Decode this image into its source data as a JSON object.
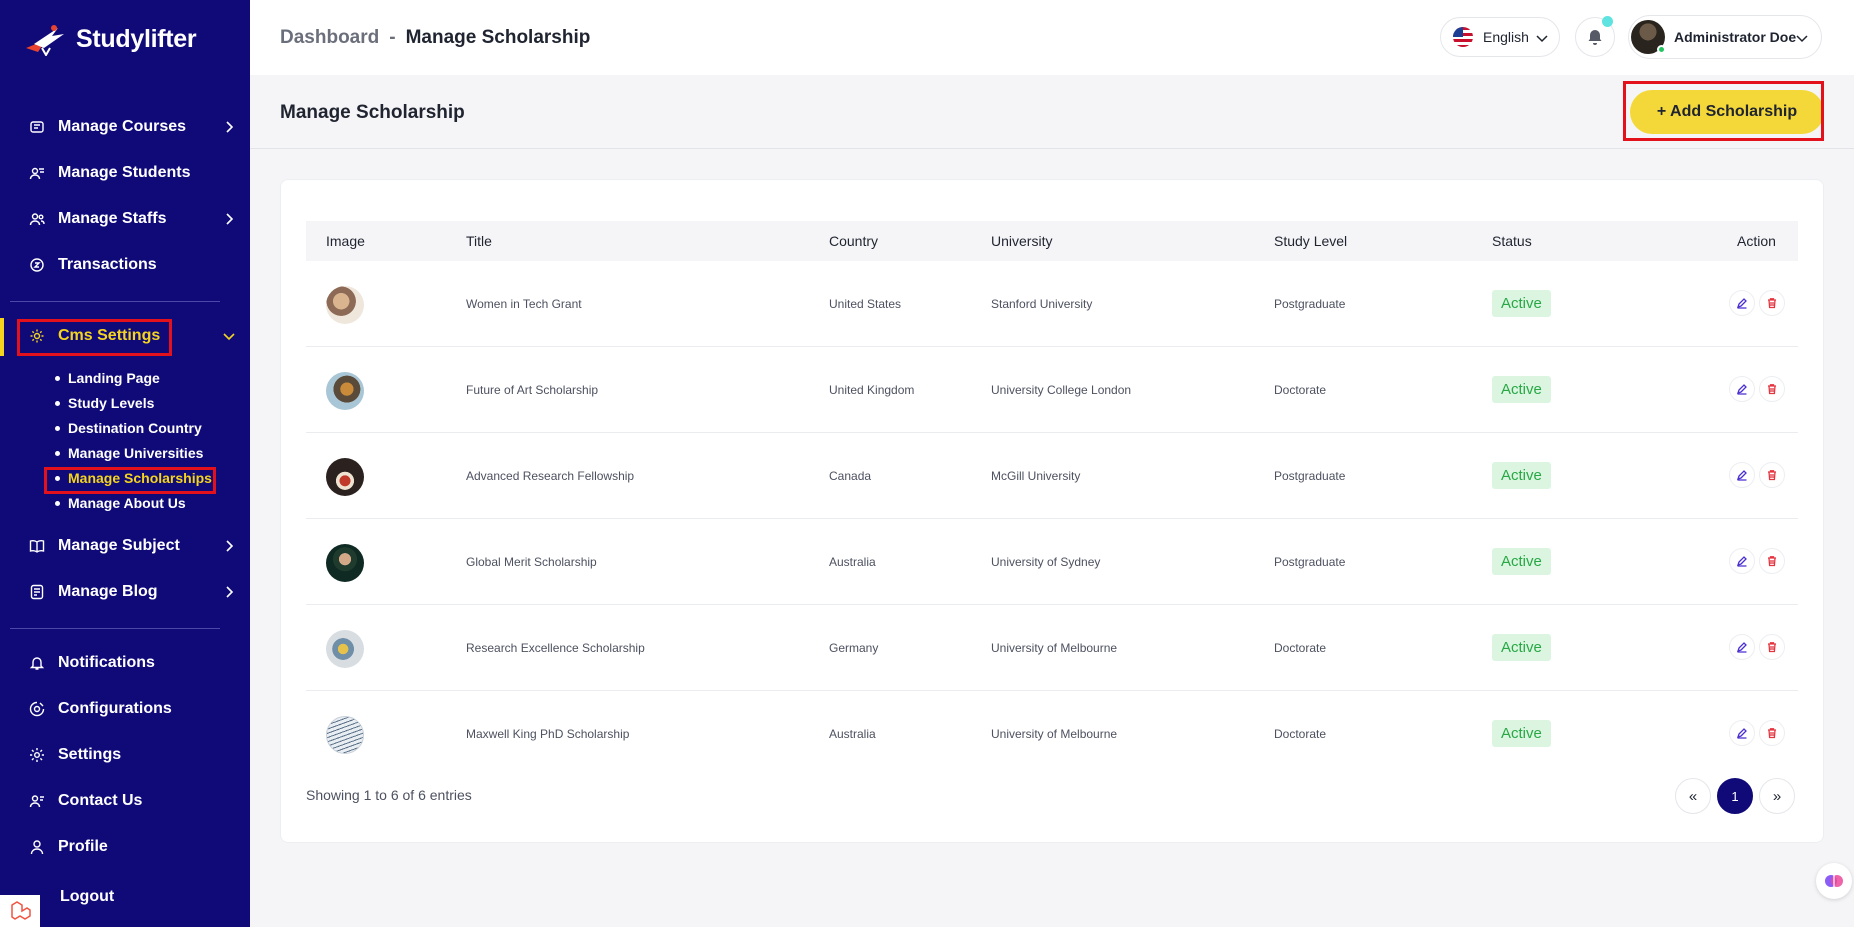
{
  "app": {
    "name": "Studylifter"
  },
  "sidebar": {
    "items_top": [
      {
        "label": "Manage Courses"
      },
      {
        "label": "Manage Students"
      },
      {
        "label": "Manage Staffs"
      },
      {
        "label": "Transactions"
      }
    ],
    "cms": {
      "label": "Cms Settings",
      "children": [
        {
          "label": "Landing Page"
        },
        {
          "label": "Study Levels"
        },
        {
          "label": "Destination Country"
        },
        {
          "label": "Manage Universities"
        },
        {
          "label": "Manage Scholarships"
        },
        {
          "label": "Manage About Us"
        }
      ]
    },
    "items_mid": [
      {
        "label": "Manage Subject"
      },
      {
        "label": "Manage Blog"
      }
    ],
    "items_bottom": [
      {
        "label": "Notifications"
      },
      {
        "label": "Configurations"
      },
      {
        "label": "Settings"
      },
      {
        "label": "Contact Us"
      },
      {
        "label": "Profile"
      },
      {
        "label": "Logout"
      }
    ],
    "accent_color": "#f4d41f",
    "background_color": "#100a78"
  },
  "header": {
    "breadcrumb": {
      "root": "Dashboard",
      "separator": "-",
      "current": "Manage Scholarship"
    },
    "language": "English",
    "user_name": "Administrator Doe"
  },
  "page": {
    "title": "Manage Scholarship",
    "add_button": "+ Add Scholarship"
  },
  "table": {
    "columns": [
      "Image",
      "Title",
      "Country",
      "University",
      "Study Level",
      "Status",
      "Action"
    ],
    "rows": [
      {
        "title": "Women in Tech Grant",
        "country": "United States",
        "university": "Stanford University",
        "level": "Postgraduate",
        "status": "Active"
      },
      {
        "title": "Future of Art Scholarship",
        "country": "United Kingdom",
        "university": "University College London",
        "level": "Doctorate",
        "status": "Active"
      },
      {
        "title": "Advanced Research Fellowship",
        "country": "Canada",
        "university": "McGill University",
        "level": "Postgraduate",
        "status": "Active"
      },
      {
        "title": "Global Merit Scholarship",
        "country": "Australia",
        "university": "University of Sydney",
        "level": "Postgraduate",
        "status": "Active"
      },
      {
        "title": "Research Excellence Scholarship",
        "country": "Germany",
        "university": "University of Melbourne",
        "level": "Doctorate",
        "status": "Active"
      },
      {
        "title": "Maxwell King PhD Scholarship",
        "country": "Australia",
        "university": "University of Melbourne",
        "level": "Doctorate",
        "status": "Active"
      }
    ],
    "footer": "Showing 1 to 6 of 6 entries",
    "pagination": {
      "prev": "«",
      "current": "1",
      "next": "»"
    }
  }
}
